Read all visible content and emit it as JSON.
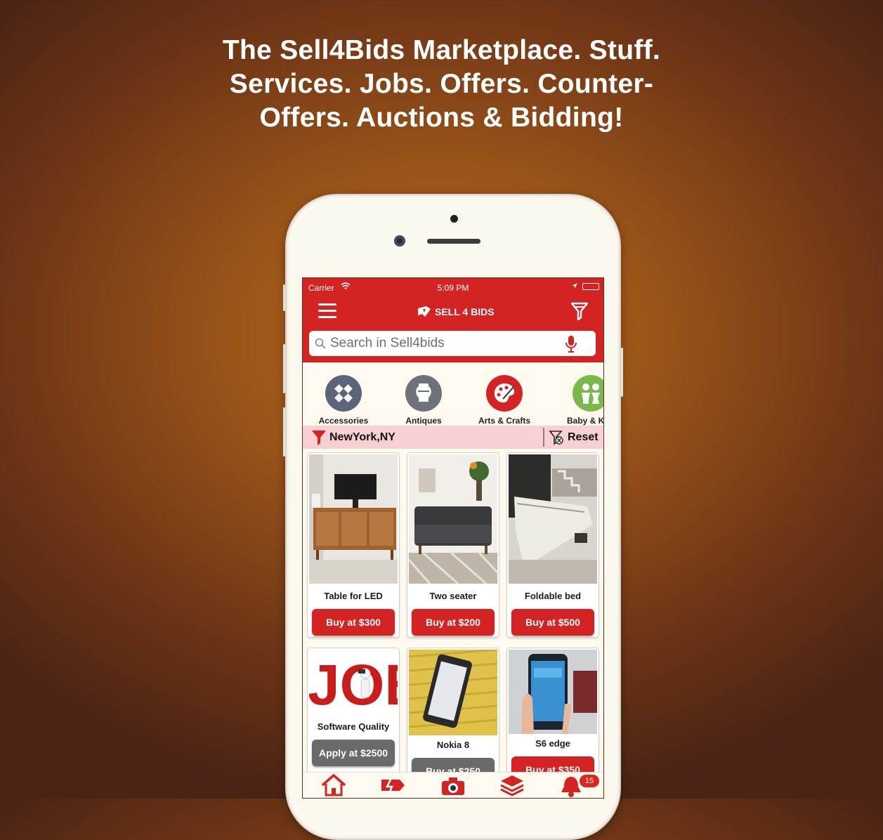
{
  "headline": {
    "line1": "The Sell4Bids Marketplace. Stuff.",
    "line2": "Services. Jobs. Offers. Counter-",
    "line3": "Offers. Auctions & Bidding!"
  },
  "status_bar": {
    "carrier": "Carrier",
    "time": "5:09 PM"
  },
  "nav": {
    "logo_text": "SELL 4 BIDS"
  },
  "search": {
    "placeholder": "Search in Sell4bids"
  },
  "categories": [
    {
      "label": "Accessories",
      "icon": "accessories-icon",
      "color": "#5b6577"
    },
    {
      "label": "Antiques",
      "icon": "antiques-icon",
      "color": "#6d727b"
    },
    {
      "label": "Arts & Crafts",
      "icon": "arts-crafts-icon",
      "color": "#d42323"
    },
    {
      "label": "Baby & K",
      "icon": "baby-kids-icon",
      "color": "#79b84a"
    }
  ],
  "location": {
    "text": "NewYork,NY",
    "reset_label": "Reset"
  },
  "products": [
    {
      "title": "Table for LED",
      "button": "Buy at $300"
    },
    {
      "title": "Two seater",
      "button": "Buy at $200"
    },
    {
      "title": "Foldable bed",
      "button": "Buy at $500"
    },
    {
      "title": "Software Quality",
      "button": "Apply at $2500"
    },
    {
      "title": "Nokia 8",
      "button": "Buy at $250"
    },
    {
      "title": "S6 edge",
      "button": "Buy at $350"
    }
  ],
  "tabbar": {
    "items": [
      "home-icon",
      "offers-icon",
      "camera-icon",
      "layers-icon",
      "bell-icon"
    ],
    "notification_count": "15"
  },
  "colors": {
    "brand_red": "#d42323",
    "location_bar": "#f8cfd2"
  }
}
